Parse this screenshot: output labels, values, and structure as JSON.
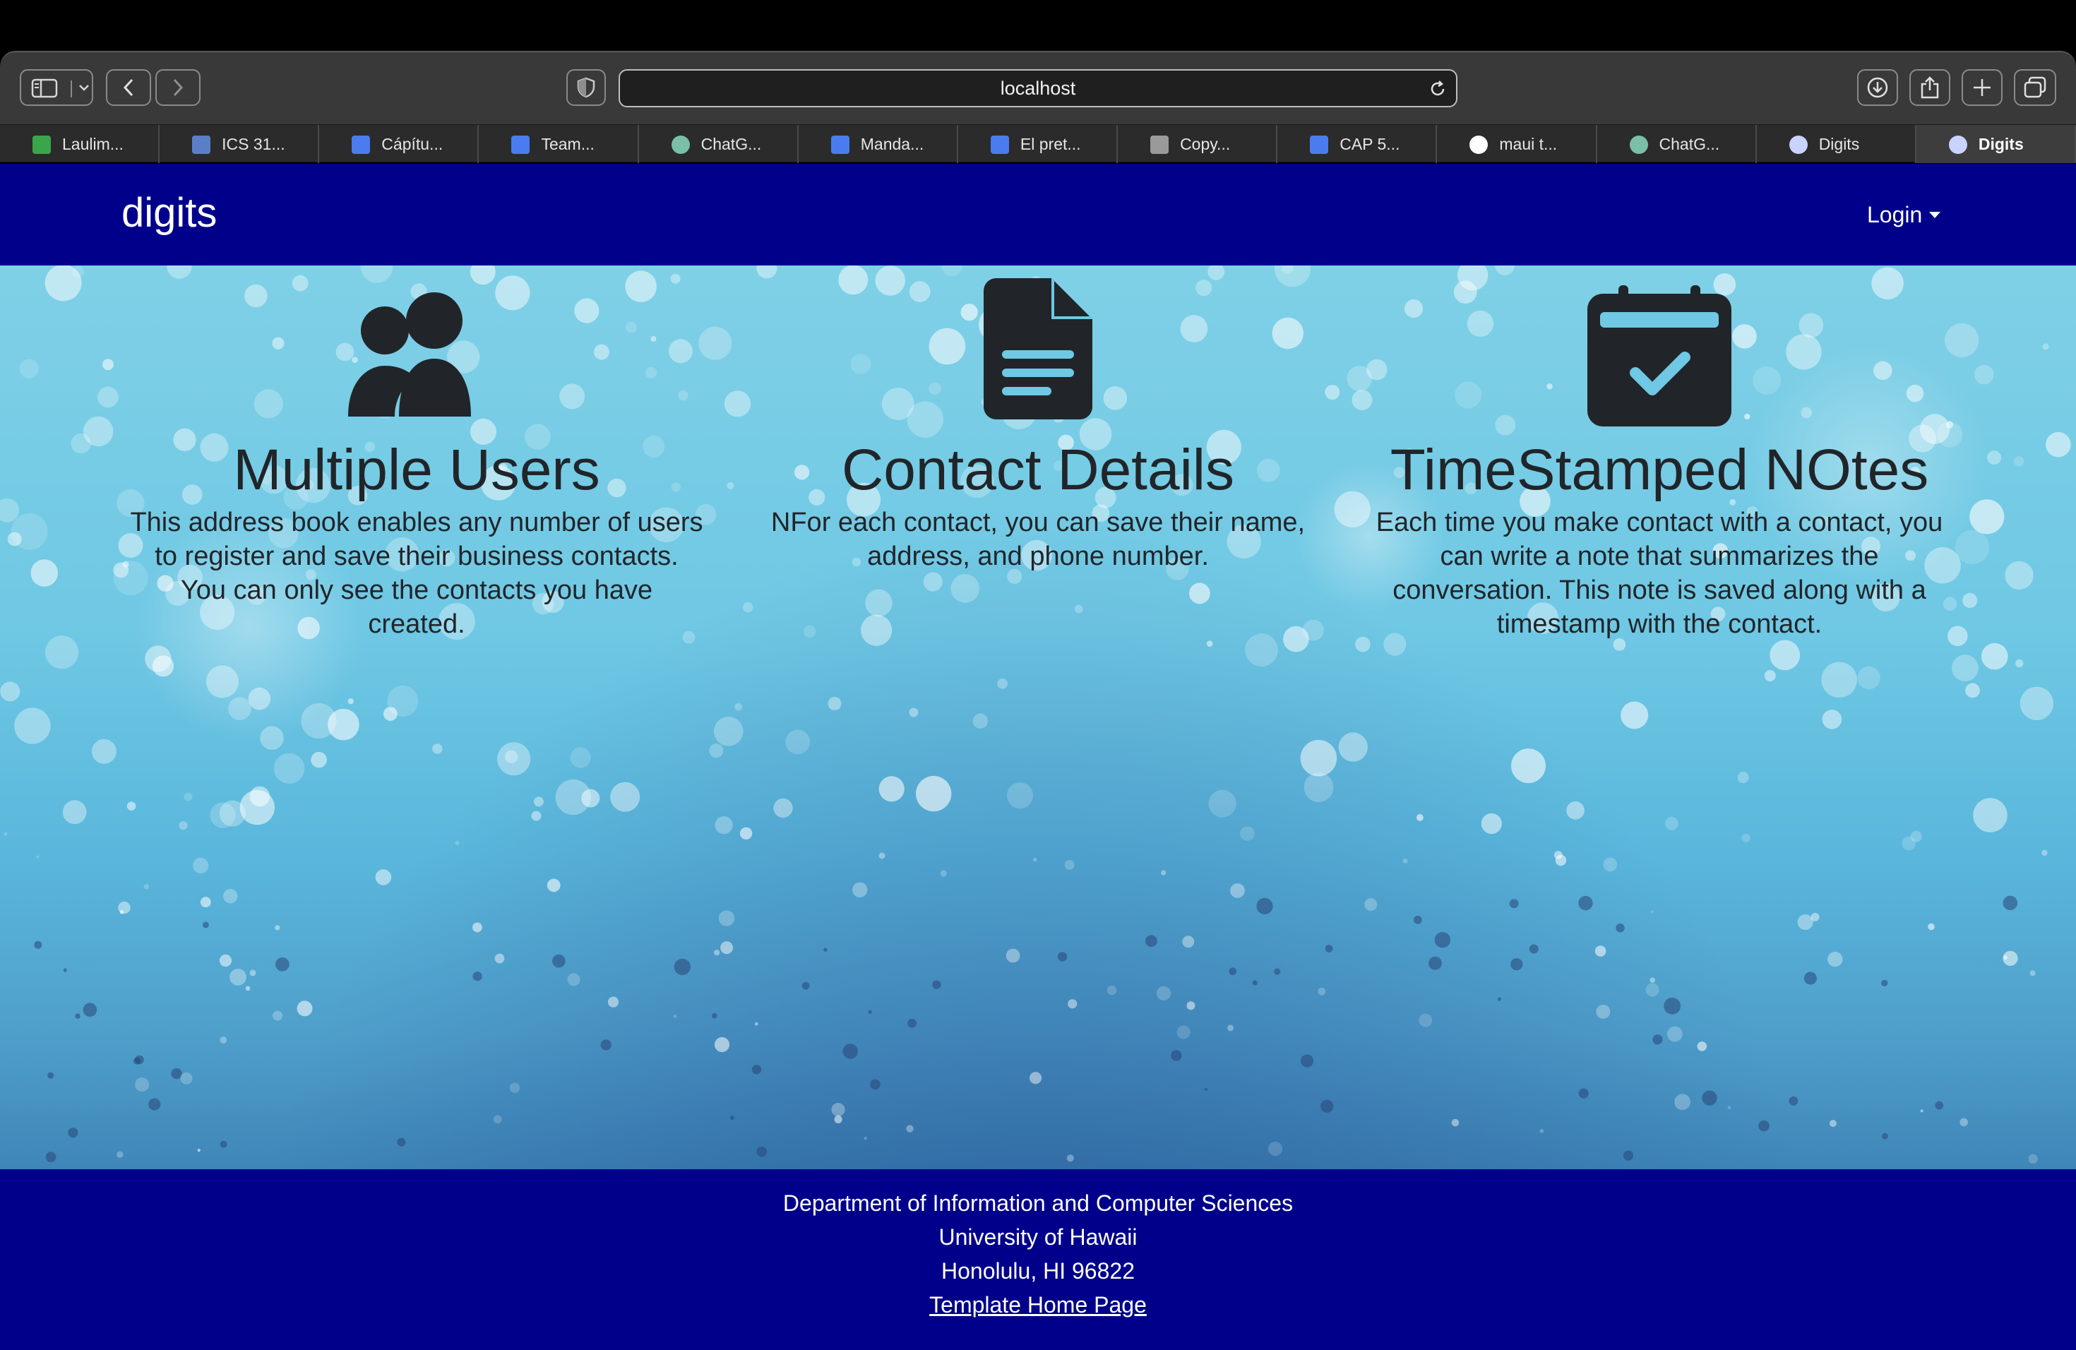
{
  "browser": {
    "url": "localhost",
    "tabs": [
      {
        "label": "Laulim...",
        "icon": "leaf-icon",
        "color": "#3aa54a"
      },
      {
        "label": "ICS 31...",
        "icon": "square-icon",
        "color": "#5b7fc7"
      },
      {
        "label": "Cápítu...",
        "icon": "docs-icon",
        "color": "#4a7cf0"
      },
      {
        "label": "Team...",
        "icon": "docs-icon",
        "color": "#4a7cf0"
      },
      {
        "label": "ChatG...",
        "icon": "chatgpt-icon",
        "color": "#7bbfa8"
      },
      {
        "label": "Manda...",
        "icon": "docs-icon",
        "color": "#4a7cf0"
      },
      {
        "label": "El pret...",
        "icon": "docs-icon",
        "color": "#4a7cf0"
      },
      {
        "label": "Copy...",
        "icon": "g-icon",
        "color": "#9a9a9a"
      },
      {
        "label": "CAP 5...",
        "icon": "docs-icon",
        "color": "#4a7cf0"
      },
      {
        "label": "maui t...",
        "icon": "google-icon",
        "color": "#ffffff"
      },
      {
        "label": "ChatG...",
        "icon": "chatgpt-icon",
        "color": "#7bbfa8"
      },
      {
        "label": "Digits",
        "icon": "meteor-icon",
        "color": "#c9d3ff"
      },
      {
        "label": "Digits",
        "icon": "meteor-icon",
        "color": "#c9d3ff",
        "active": true
      }
    ]
  },
  "navbar": {
    "brand": "digits",
    "login_label": "Login"
  },
  "features": [
    {
      "icon": "users-icon",
      "title": "Multiple Users",
      "description": "This address book enables any number of users to register and save their business contacts. You can only see the contacts you have created."
    },
    {
      "icon": "file-lines-icon",
      "title": "Contact Details",
      "description": "NFor each contact, you can save their name, address, and phone number."
    },
    {
      "icon": "calendar-check-icon",
      "title": "TimeStamped NOtes",
      "description": "Each time you make contact with a contact, you can write a note that summarizes the conversation. This note is saved along with a timestamp with the contact."
    }
  ],
  "footer": {
    "line1": "Department of Information and Computer Sciences",
    "line2": "University of Hawaii",
    "line3": "Honolulu, HI 96822",
    "link_label": "Template Home Page"
  },
  "colors": {
    "navbar_bg": "#00008b",
    "text_dark": "#212529"
  }
}
